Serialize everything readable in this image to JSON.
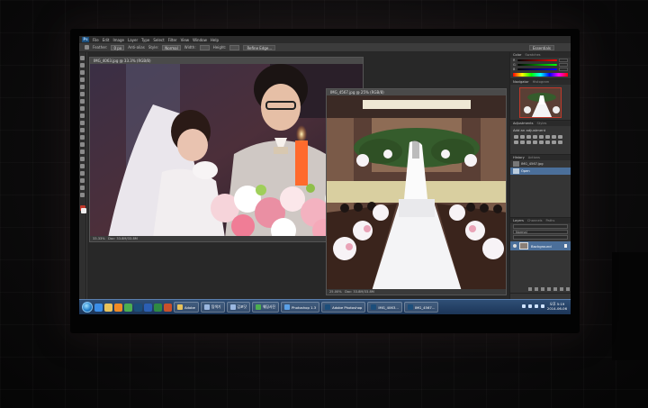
{
  "app": {
    "logo": "Ps",
    "menus": [
      "File",
      "Edit",
      "Image",
      "Layer",
      "Type",
      "Select",
      "Filter",
      "View",
      "Window",
      "Help"
    ]
  },
  "options": {
    "feather_label": "Feather:",
    "feather_value": "0 px",
    "antialias": "Anti-alias",
    "style_label": "Style:",
    "style_value": "Normal",
    "width_label": "Width:",
    "height_label": "Height:",
    "refine_edge": "Refine Edge...",
    "workspace": "Essentials"
  },
  "documents": [
    {
      "title": "IMG_4063.jpg @ 33.3% (RGB/8)",
      "status": "33.33%",
      "doc_size": "Doc: 33.8M/33.8M"
    },
    {
      "title": "IMG_4567.jpg @ 25% (RGB/8)",
      "status": "25.00%",
      "doc_size": "Doc: 33.8M/33.8M"
    }
  ],
  "panels": {
    "color_tabs": [
      "Color",
      "Swatches"
    ],
    "navigator_tabs": [
      "Navigator",
      "Histogram"
    ],
    "adjustments_tabs": [
      "Adjustments",
      "Styles"
    ],
    "adjustments_title": "Add an adjustment",
    "history_tabs": [
      "History",
      "Actions"
    ],
    "history_items": [
      "IMG_4567.jpg",
      "Open"
    ],
    "layers_tabs": [
      "Layers",
      "Channels",
      "Paths"
    ],
    "blend_mode": "Normal",
    "layer_name": "Background"
  },
  "taskbar": {
    "buttons": [
      "Adobe",
      "탐색기",
      "김포닷",
      "웨딩사진",
      "Photoshop 1.3",
      "Adobe Photoshop",
      "IMG_4063...",
      "IMG_4567..."
    ],
    "time": "오후 5:19",
    "date": "2014-06-06"
  },
  "colors": {
    "accent": "#4b6f9a",
    "ps_blue": "#1c4e7b",
    "foreground_swatch": "#c0392b"
  }
}
